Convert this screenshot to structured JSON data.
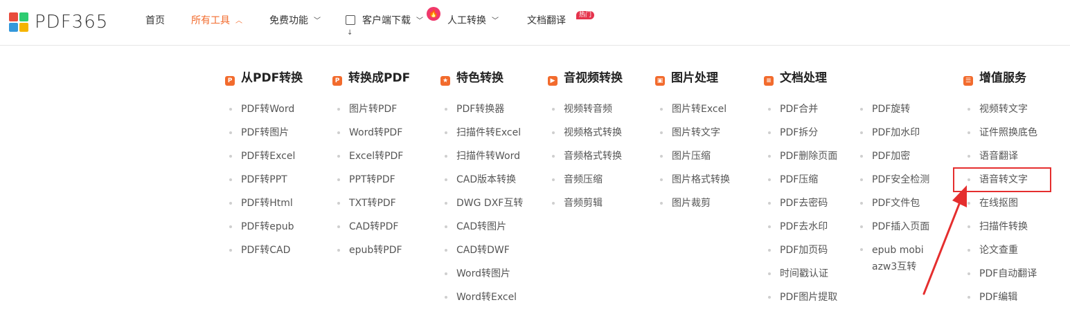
{
  "logo": {
    "text": "PDF365"
  },
  "nav": {
    "home": "首页",
    "all_tools": "所有工具",
    "free": "免费功能",
    "download": "客户端下载",
    "manual": "人工转换",
    "translate": "文档翻译",
    "hot_badge": "热门"
  },
  "columns": [
    {
      "title": "从PDF转换",
      "items": [
        "PDF转Word",
        "PDF转图片",
        "PDF转Excel",
        "PDF转PPT",
        "PDF转Html",
        "PDF转epub",
        "PDF转CAD"
      ]
    },
    {
      "title": "转换成PDF",
      "items": [
        "图片转PDF",
        "Word转PDF",
        "Excel转PDF",
        "PPT转PDF",
        "TXT转PDF",
        "CAD转PDF",
        "epub转PDF"
      ]
    },
    {
      "title": "特色转换",
      "items": [
        "PDF转换器",
        "扫描件转Excel",
        "扫描件转Word",
        "CAD版本转换",
        "DWG DXF互转",
        "CAD转图片",
        "CAD转DWF",
        "Word转图片",
        "Word转Excel"
      ]
    },
    {
      "title": "音视频转换",
      "items": [
        "视频转音频",
        "视频格式转换",
        "音频格式转换",
        "音频压缩",
        "音频剪辑"
      ]
    },
    {
      "title": "图片处理",
      "items": [
        "图片转Excel",
        "图片转文字",
        "图片压缩",
        "图片格式转换",
        "图片裁剪"
      ]
    },
    {
      "title": "文档处理",
      "items": [
        "PDF合并",
        "PDF拆分",
        "PDF删除页面",
        "PDF压缩",
        "PDF去密码",
        "PDF去水印",
        "PDF加页码",
        "时间戳认证",
        "PDF图片提取"
      ],
      "items2": [
        "PDF旋转",
        "PDF加水印",
        "PDF加密",
        "PDF安全检测",
        "PDF文件包",
        "PDF插入页面",
        "epub mobi azw3互转"
      ]
    },
    {
      "title": "增值服务",
      "items": [
        "视频转文字",
        "证件照换底色",
        "语音翻译",
        "语音转文字",
        "在线抠图",
        "扫描件转换",
        "论文查重",
        "PDF自动翻译",
        "PDF编辑"
      ]
    }
  ],
  "colors": {
    "accent": "#f26b2d",
    "highlight": "#e52e2e"
  }
}
